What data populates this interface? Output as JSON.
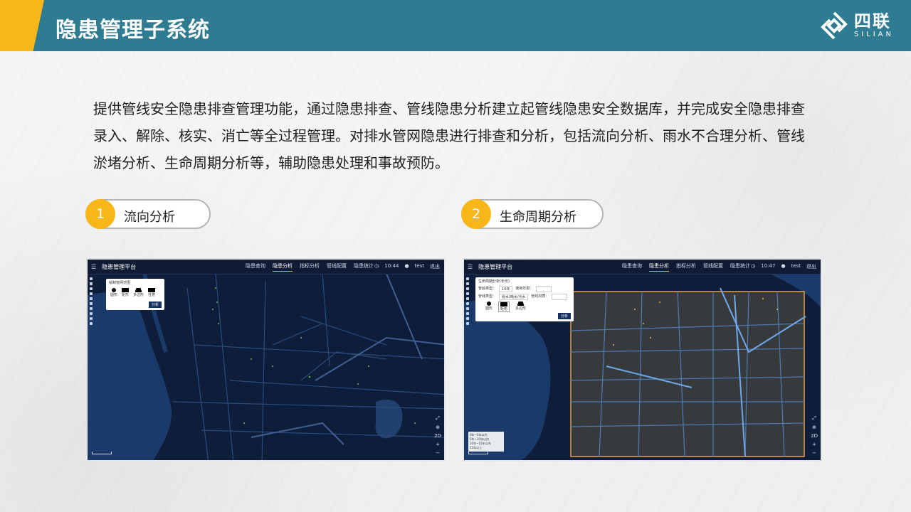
{
  "header": {
    "title": "隐患管理子系统"
  },
  "logo": {
    "cn": "四联",
    "en": "SILIAN"
  },
  "intro": "提供管线安全隐患排查管理功能，通过隐患排查、管线隐患分析建立起管线隐患安全数据库，并完成安全隐患排查录入、解除、核实、消亡等全过程管理。对排水管网隐患进行排查和分析，包括流向分析、雨水不合理分析、管线淤堵分析、生命周期分析等，辅助隐患处理和事故预防。",
  "sections": [
    {
      "num": "1",
      "label": "流向分析"
    },
    {
      "num": "2",
      "label": "生命周期分析"
    }
  ],
  "screens": [
    {
      "brand": "隐患管理平台",
      "nav": [
        "隐患查询",
        "隐患分析",
        "指标分析",
        "管线配置",
        "隐患统计"
      ],
      "active_nav": "隐患分析",
      "time": "10:44",
      "user": "test",
      "logout": "退出",
      "panel_title": "绘制管网范围",
      "shapes": [
        "圆形",
        "矩形",
        "多边形",
        "任意"
      ],
      "panel_button": "分析",
      "zoom_mode": "2D"
    },
    {
      "brand": "隐患管理平台",
      "nav": [
        "隐患查询",
        "隐患分析",
        "指标分析",
        "管线配置",
        "隐患统计"
      ],
      "active_nav": "隐患分析",
      "time": "10:47",
      "user": "test",
      "logout": "退出",
      "panel_title": "生命周期分析(年份)",
      "field1_label": "管龄类型：",
      "field1_value": "10年",
      "field2_label": "使用年限：",
      "field3_label": "管线类型：",
      "field3_value": "给水/雨水/污水",
      "field4_label": "管线材质：",
      "shapes": [
        "圆形",
        "矩形",
        "多边形"
      ],
      "panel_button": "分析",
      "legend": [
        "0年~5年以内",
        "5年~10年以内",
        "10年~15年以内",
        "15年以上"
      ],
      "zoom_mode": "2D"
    }
  ]
}
